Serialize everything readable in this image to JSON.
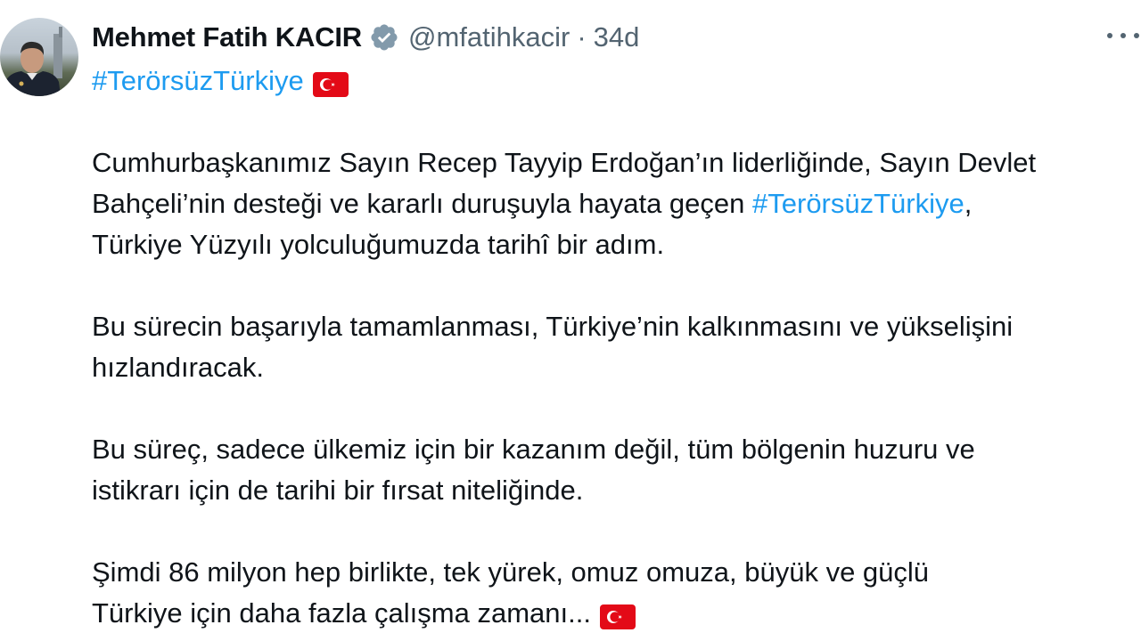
{
  "tweet": {
    "author": {
      "name": "Mehmet Fatih KACIR",
      "handle": "@mfatihkacir",
      "separator": "·",
      "time": "34d"
    },
    "hashtag_line": "#TerörsüzTürkiye",
    "paragraph1": {
      "line1": "Cumhurbaşkanımız Sayın Recep Tayyip Erdoğan’ın liderliğinde, Sayın Devlet",
      "line2_before": "Bahçeli’nin desteği ve kararlı duruşuyla hayata geçen ",
      "line2_hashtag": "#TerörsüzTürkiye",
      "line2_after": ",",
      "line3": "Türkiye Yüzyılı yolculuğumuzda tarihî bir adım."
    },
    "paragraph2": {
      "line1": "Bu sürecin başarıyla tamamlanması, Türkiye’nin kalkınmasını ve yükselişini",
      "line2": "hızlandıracak."
    },
    "paragraph3": {
      "line1": "Bu süreç, sadece ülkemiz için bir kazanım değil, tüm bölgenin huzuru ve",
      "line2": "istikrarı için de tarihi bir fırsat niteliğinde."
    },
    "paragraph4": {
      "line1": "Şimdi 86 milyon hep birlikte, tek yürek, omuz omuza, büyük ve güçlü",
      "line2": "Türkiye için daha fazla çalışma zamanı..."
    }
  },
  "icons": {
    "verified": "verified-badge-icon",
    "flag": "turkey-flag-icon",
    "more": "more-options-icon"
  },
  "colors": {
    "hashtag": "#1d9bf0",
    "secondary_text": "#536471",
    "primary_text": "#0f1419",
    "flag_red": "#e30a17"
  }
}
